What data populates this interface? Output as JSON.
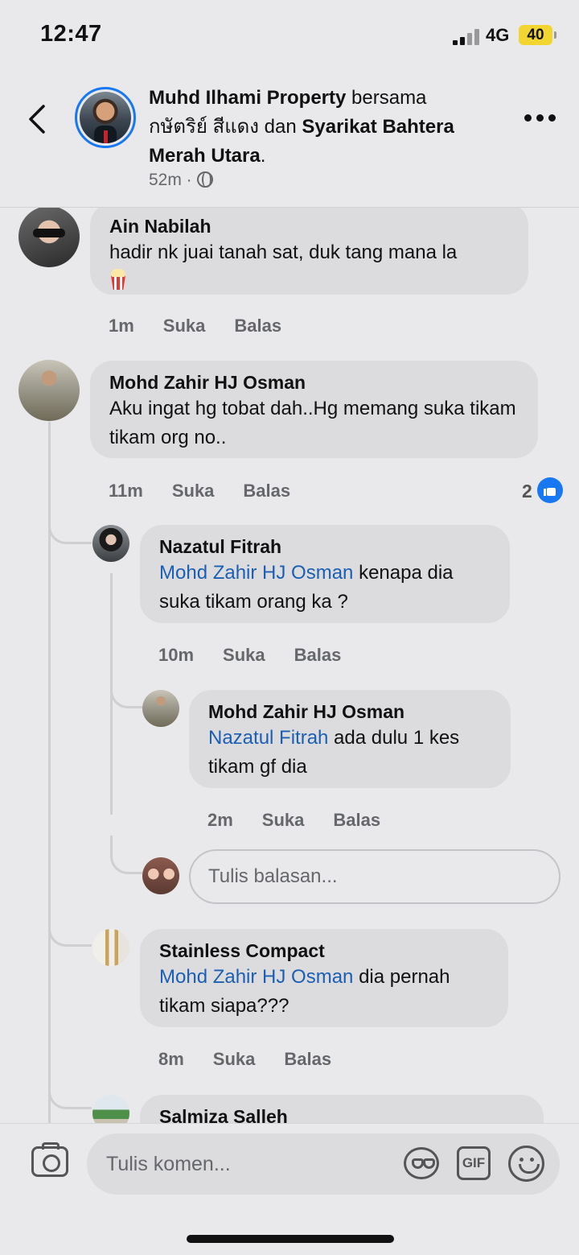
{
  "status": {
    "time": "12:47",
    "network": "4G",
    "battery": "40"
  },
  "header": {
    "author": "Muhd Ilhami Property",
    "with": "bersama",
    "tag1": "กษัตริย์ สีแดง",
    "and": "dan",
    "tag2": "Syarikat Bahtera Merah Utara",
    "period": ".",
    "time": "52m ·"
  },
  "comments": [
    {
      "name": "Ain Nabilah",
      "text": "hadir nk juai tanah sat, duk tang mana la",
      "time": "1m",
      "like": "Suka",
      "reply": "Balas"
    },
    {
      "name": "Mohd Zahir HJ Osman",
      "text": "Aku ingat hg tobat dah..Hg memang suka tikam tikam org no..",
      "time": "11m",
      "like": "Suka",
      "reply": "Balas",
      "reactions": "2"
    },
    {
      "name": "Nazatul Fitrah",
      "mention": "Mohd Zahir HJ Osman",
      "text": " kenapa dia suka tikam orang ka ?",
      "time": "10m",
      "like": "Suka",
      "reply": "Balas"
    },
    {
      "name": "Mohd Zahir HJ Osman",
      "mention": "Nazatul Fitrah",
      "text": " ada dulu 1 kes tikam gf dia",
      "time": "2m",
      "like": "Suka",
      "reply": "Balas"
    },
    {
      "name": "Stainless Compact",
      "mention": "Mohd Zahir HJ Osman",
      "text": " dia pernah tikam siapa???",
      "time": "8m",
      "like": "Suka",
      "reply": "Balas"
    },
    {
      "name": "Salmiza Salleh"
    }
  ],
  "reply_placeholder": "Tulis balasan...",
  "comment_placeholder": "Tulis komen...",
  "gif_label": "GIF",
  "colors": {
    "accent": "#1877f2",
    "mention": "#1a5fb4",
    "bubble": "#dcdcdf",
    "background": "#e9e9eb"
  }
}
